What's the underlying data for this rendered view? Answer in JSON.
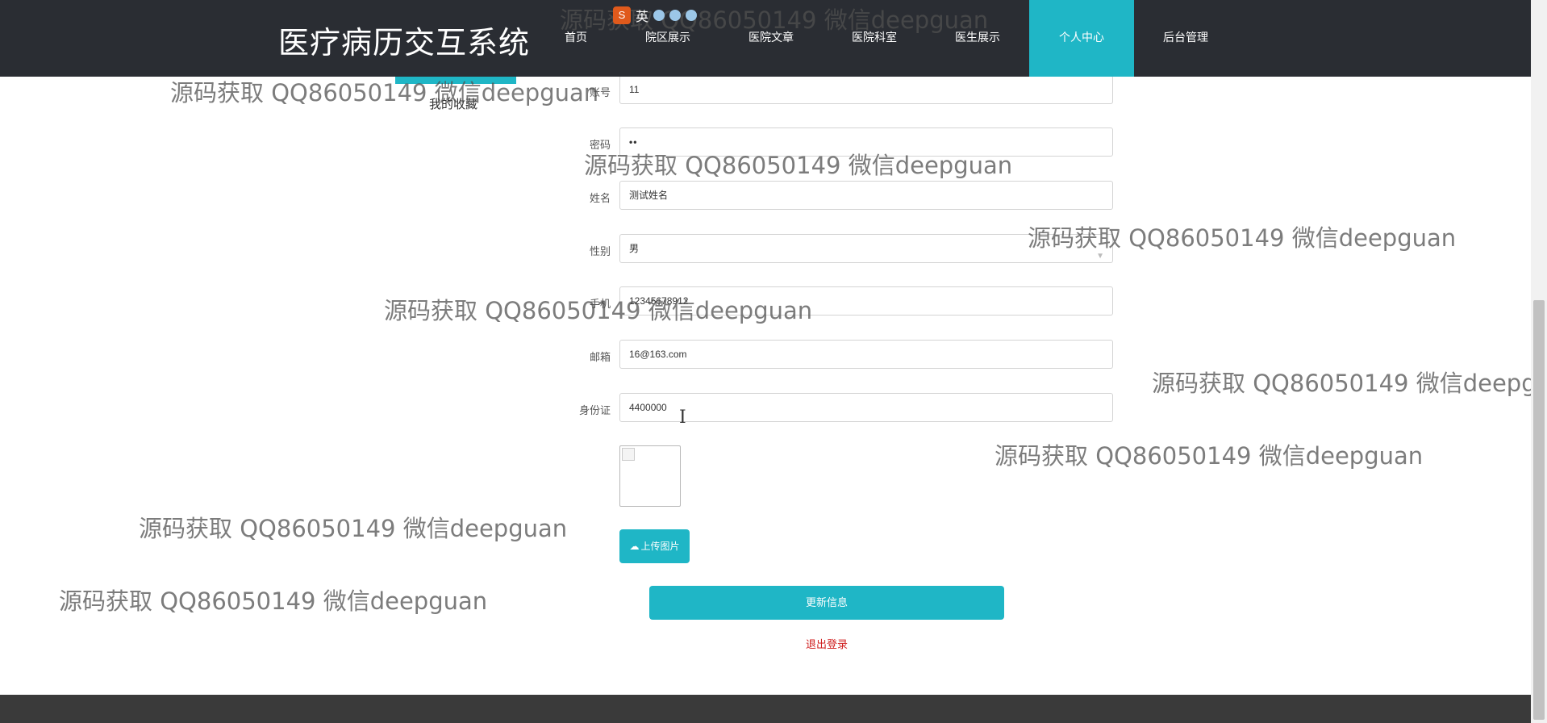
{
  "header": {
    "brand": "医疗病历交互系统",
    "nav": [
      {
        "label": "首页",
        "active": false
      },
      {
        "label": "院区展示",
        "active": false
      },
      {
        "label": "医院文章",
        "active": false
      },
      {
        "label": "医院科室",
        "active": false
      },
      {
        "label": "医生展示",
        "active": false
      },
      {
        "label": "个人中心",
        "active": true
      },
      {
        "label": "后台管理",
        "active": false
      }
    ]
  },
  "side_menu": {
    "favorites_label": "我的收藏"
  },
  "form": {
    "account": {
      "label": "账号",
      "value": "11"
    },
    "password": {
      "label": "密码",
      "value": "••"
    },
    "name": {
      "label": "姓名",
      "value": "测试姓名"
    },
    "gender": {
      "label": "性别",
      "value": "男"
    },
    "phone": {
      "label": "手机",
      "value": "12345678912"
    },
    "email": {
      "label": "邮箱",
      "value": "16@163.com"
    },
    "id_card": {
      "label": "身份证",
      "value": "4400000"
    }
  },
  "buttons": {
    "upload": "上传图片",
    "update": "更新信息",
    "logout": "退出登录"
  },
  "badge": {
    "text": "英"
  },
  "watermark": "源码获取 QQ86050149 微信deepguan",
  "colors": {
    "header_bg": "#2a2d33",
    "accent": "#1fb6c6",
    "logout": "#d01f1f",
    "footer_bg": "#3a3a3a"
  }
}
